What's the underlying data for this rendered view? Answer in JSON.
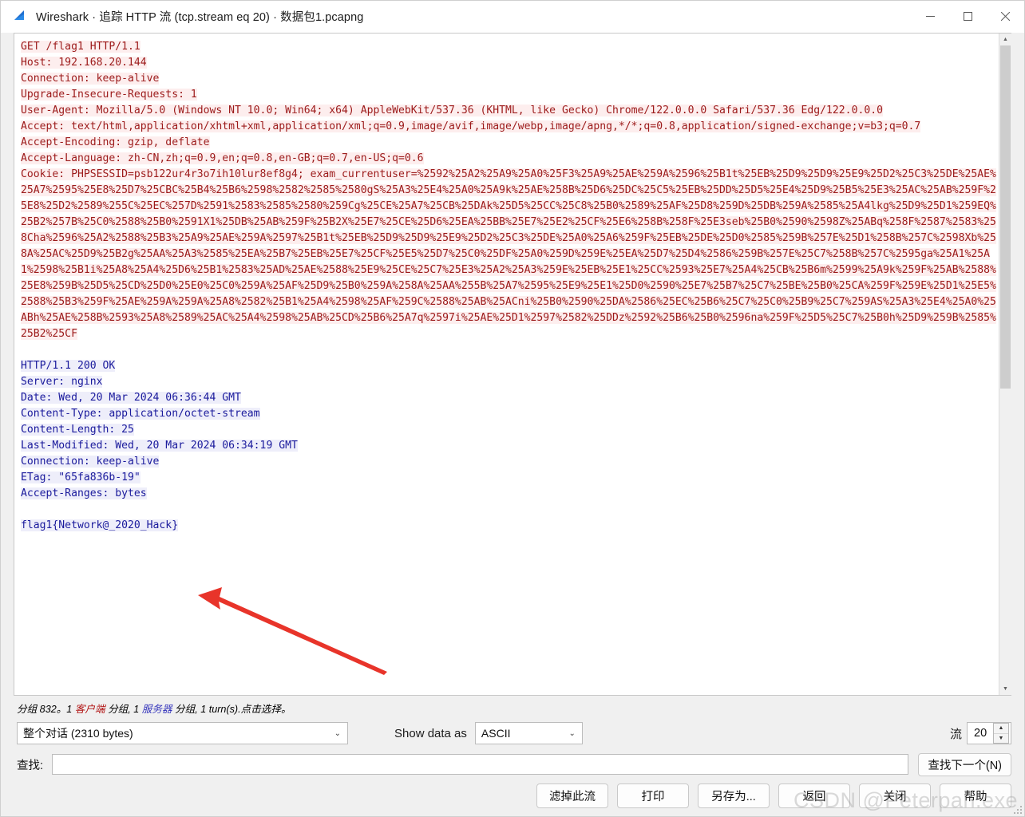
{
  "window": {
    "title": "Wireshark · 追踪 HTTP 流 (tcp.stream eq 20) · 数据包1.pcapng",
    "icon": "wireshark-fin-icon",
    "minimize_label": "—",
    "maximize_label": "□",
    "close_label": "✕"
  },
  "stream": {
    "request": [
      "GET /flag1 HTTP/1.1",
      "Host: 192.168.20.144",
      "Connection: keep-alive",
      "Upgrade-Insecure-Requests: 1",
      "User-Agent: Mozilla/5.0 (Windows NT 10.0; Win64; x64) AppleWebKit/537.36 (KHTML, like Gecko) Chrome/122.0.0.0 Safari/537.36 Edg/122.0.0.0",
      "Accept: text/html,application/xhtml+xml,application/xml;q=0.9,image/avif,image/webp,image/apng,*/*;q=0.8,application/signed-exchange;v=b3;q=0.7",
      "Accept-Encoding: gzip, deflate",
      "Accept-Language: zh-CN,zh;q=0.9,en;q=0.8,en-GB;q=0.7,en-US;q=0.6",
      "Cookie: PHPSESSID=psb122ur4r3o7ih10lur8ef8g4; exam_currentuser=%2592%25A2%25A9%25A0%25F3%25A9%25AE%259A%2596%25B1t%25EB%25D9%25D9%25E9%25D2%25C3%25DE%25AE%25A7%2595%25E8%25D7%25CBC%25B4%25B6%2598%2582%2585%2580gS%25A3%25E4%25A0%25A9k%25AE%258B%25D6%25DC%25C5%25EB%25DD%25D5%25E4%25D9%25B5%25E3%25AC%25AB%259F%25E8%25D2%2589%255C%25EC%257D%2591%2583%2585%2580%259Cg%25CE%25A7%25CB%25DAk%25D5%25CC%25C8%25B0%2589%25AF%25D8%259D%25DB%259A%2585%25A4lkg%25D9%25D1%259EQ%25B2%257B%25C0%2588%25B0%2591X1%25DB%25AB%259F%25B2X%25E7%25CE%25D6%25EA%25BB%25E7%25E2%25CF%25E6%258B%258F%25E3seb%25B0%2590%2598Z%25ABq%258F%2587%2583%258Cha%2596%25A2%2588%25B3%25A9%25AE%259A%2597%25B1t%25EB%25D9%25D9%25E9%25D2%25C3%25DE%25A0%25A6%259F%25EB%25DE%25D0%2585%259B%257E%25D1%258B%257C%2598Xb%258A%25AC%25D9%25B2g%25AA%25A3%2585%25EA%25B7%25EB%25E7%25CF%25E5%25D7%25C0%25DF%25A0%259D%259E%25EA%25D7%25D4%2586%259B%257E%25C7%258B%257C%2595ga%25A1%25A1%2598%25B1i%25A8%25A4%25D6%25B1%2583%25AD%25AE%2588%25E9%25CE%25C7%25E3%25A2%25A3%259E%25EB%25E1%25CC%2593%25E7%25A4%25CB%25B6m%2599%25A9k%259F%25AB%2588%25E8%259B%25D5%25CD%25D0%25E0%25C0%259A%25AF%25D9%25B0%259A%258A%25AA%255B%25A7%2595%25E9%25E1%25D0%2590%25E7%25B7%25C7%25BE%25B0%25CA%259F%259E%25D1%25E5%2588%25B3%259F%25AE%259A%259A%25A8%2582%25B1%25A4%2598%25AF%259C%2588%25AB%25ACni%25B0%2590%25DA%2586%25EC%25B6%25C7%25C0%25B9%25C7%259AS%25A3%25E4%25A0%25ABh%25AE%258B%2593%25A8%2589%25AC%25A4%2598%25AB%25CD%25B6%25A7q%2597i%25AE%25D1%2597%2582%25DDz%2592%25B6%25B0%2596na%259F%25D5%25C7%25B0h%25D9%259B%2585%25B2%25CF"
    ],
    "response": [
      "HTTP/1.1 200 OK",
      "Server: nginx",
      "Date: Wed, 20 Mar 2024 06:36:44 GMT",
      "Content-Type: application/octet-stream",
      "Content-Length: 25",
      "Last-Modified: Wed, 20 Mar 2024 06:34:19 GMT",
      "Connection: keep-alive",
      "ETag: \"65fa836b-19\"",
      "Accept-Ranges: bytes"
    ],
    "body": "flag1{Network@_2020_Hack}",
    "colors": {
      "request_text": "#9c1a1a",
      "request_bg": "#fdeeee",
      "response_text": "#1a1a9c",
      "response_bg": "#eeeefa",
      "annotation_arrow": "#e8342a"
    }
  },
  "status": {
    "prefix": "分组 832。1 ",
    "client_label": "客户端",
    "middle": " 分组, 1 ",
    "server_label": "服务器",
    "suffix": " 分组, 1 turn(s).点击选择。"
  },
  "controls": {
    "conversation_value": "整个对话 (2310 bytes)",
    "show_data_as_label": "Show data as",
    "data_as_value": "ASCII",
    "stream_label": "流",
    "stream_value": "20",
    "chevron": "⌄",
    "spin_up": "▲",
    "spin_down": "▼"
  },
  "find": {
    "label": "查找:",
    "value": "",
    "placeholder": "",
    "next_button": "查找下一个(N)"
  },
  "buttons": [
    {
      "name": "filter-out-stream",
      "label": "滤掉此流"
    },
    {
      "name": "print",
      "label": "打印"
    },
    {
      "name": "save-as",
      "label": "另存为..."
    },
    {
      "name": "back",
      "label": "返回"
    },
    {
      "name": "close",
      "label": "关闭"
    },
    {
      "name": "help",
      "label": "帮助"
    }
  ],
  "watermark": "CSDN @Peterpan.exe"
}
